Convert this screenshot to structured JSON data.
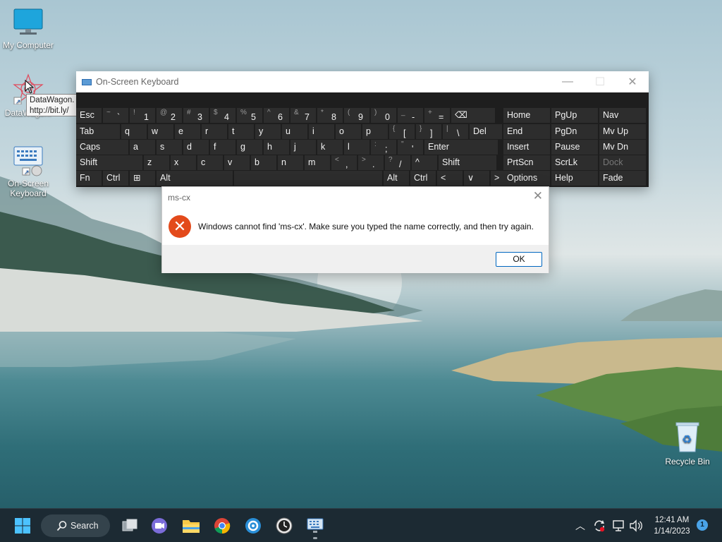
{
  "desktop": {
    "icons": {
      "my_computer": "My Computer",
      "datawagon": "DataWagon.",
      "osk": "On-Screen Keyboard",
      "recycle_bin": "Recycle Bin"
    },
    "tooltip": {
      "line1": "DataWagon.",
      "line2": "http://bit.ly/"
    }
  },
  "osk": {
    "title": "On-Screen Keyboard",
    "rows": [
      [
        {
          "label": "Esc"
        },
        {
          "sec": "~",
          "pri": "`"
        },
        {
          "sec": "!",
          "pri": "1"
        },
        {
          "sec": "@",
          "pri": "2"
        },
        {
          "sec": "#",
          "pri": "3"
        },
        {
          "sec": "$",
          "pri": "4"
        },
        {
          "sec": "%",
          "pri": "5"
        },
        {
          "sec": "^",
          "pri": "6"
        },
        {
          "sec": "&",
          "pri": "7"
        },
        {
          "sec": "*",
          "pri": "8"
        },
        {
          "sec": "(",
          "pri": "9"
        },
        {
          "sec": ")",
          "pri": "0"
        },
        {
          "sec": "_",
          "pri": "-"
        },
        {
          "sec": "+",
          "pri": "="
        },
        {
          "label": "⌫"
        }
      ],
      [
        {
          "label": "Tab"
        },
        {
          "label": "q"
        },
        {
          "label": "w"
        },
        {
          "label": "e"
        },
        {
          "label": "r"
        },
        {
          "label": "t"
        },
        {
          "label": "y"
        },
        {
          "label": "u"
        },
        {
          "label": "i"
        },
        {
          "label": "o"
        },
        {
          "label": "p"
        },
        {
          "sec": "{",
          "pri": "["
        },
        {
          "sec": "}",
          "pri": "]"
        },
        {
          "sec": "|",
          "pri": "\\"
        },
        {
          "label": "Del"
        }
      ],
      [
        {
          "label": "Caps"
        },
        {
          "label": "a"
        },
        {
          "label": "s"
        },
        {
          "label": "d"
        },
        {
          "label": "f"
        },
        {
          "label": "g"
        },
        {
          "label": "h"
        },
        {
          "label": "j"
        },
        {
          "label": "k"
        },
        {
          "label": "l"
        },
        {
          "sec": ":",
          "pri": ";"
        },
        {
          "sec": "\"",
          "pri": "'"
        },
        {
          "label": "Enter"
        }
      ],
      [
        {
          "label": "Shift"
        },
        {
          "label": "z"
        },
        {
          "label": "x"
        },
        {
          "label": "c"
        },
        {
          "label": "v"
        },
        {
          "label": "b"
        },
        {
          "label": "n"
        },
        {
          "label": "m"
        },
        {
          "sec": "<",
          "pri": ","
        },
        {
          "sec": ">",
          "pri": "."
        },
        {
          "sec": "?",
          "pri": "/"
        },
        {
          "label": "^"
        },
        {
          "label": "Shift"
        }
      ],
      [
        {
          "label": "Fn"
        },
        {
          "label": "Ctrl"
        },
        {
          "label": "⊞"
        },
        {
          "label": "Alt"
        },
        {
          "label": ""
        },
        {
          "label": "Alt"
        },
        {
          "label": "Ctrl"
        },
        {
          "label": "<"
        },
        {
          "label": "∨"
        },
        {
          "label": ">"
        },
        {
          "label": "▤"
        }
      ]
    ],
    "nav_keys": [
      [
        "Home",
        "PgUp",
        "Nav"
      ],
      [
        "End",
        "PgDn",
        "Mv Up"
      ],
      [
        "Insert",
        "Pause",
        "Mv Dn"
      ],
      [
        "PrtScn",
        "ScrLk",
        "Dock"
      ],
      [
        "Options",
        "Help",
        "Fade"
      ]
    ]
  },
  "dialog": {
    "title": "ms-cx",
    "message": "Windows cannot find 'ms-cx'. Make sure you typed the name correctly, and then try again.",
    "ok_label": "OK"
  },
  "taskbar": {
    "search_label": "Search",
    "time": "12:41 AM",
    "date": "1/14/2023",
    "notification_count": "1"
  }
}
